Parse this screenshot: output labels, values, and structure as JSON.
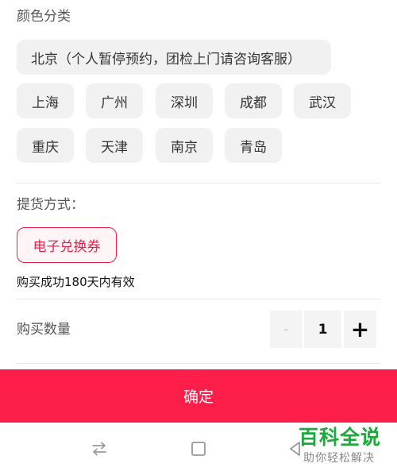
{
  "color_section": {
    "title": "颜色分类",
    "options": [
      "北京（个人暂停预约，团检上门请咨询客服）",
      "上海",
      "广州",
      "深圳",
      "成都",
      "武汉",
      "重庆",
      "天津",
      "南京",
      "青岛"
    ]
  },
  "delivery_section": {
    "title": "提货方式：",
    "selected_option": "电子兑换券",
    "validity_note": "购买成功180天内有效",
    "accent_color": "#e8204a"
  },
  "quantity_section": {
    "label": "购买数量",
    "minus": "-",
    "value": "1",
    "plus": "+"
  },
  "confirm": {
    "label": "确定",
    "color": "#fe1e4a"
  },
  "nav_bar": {
    "icons": [
      "switch-arrows-icon",
      "square-home-icon",
      "back-triangle-icon"
    ]
  },
  "watermark": {
    "title": "百科全说",
    "subtitle": "助你轻松解决"
  }
}
